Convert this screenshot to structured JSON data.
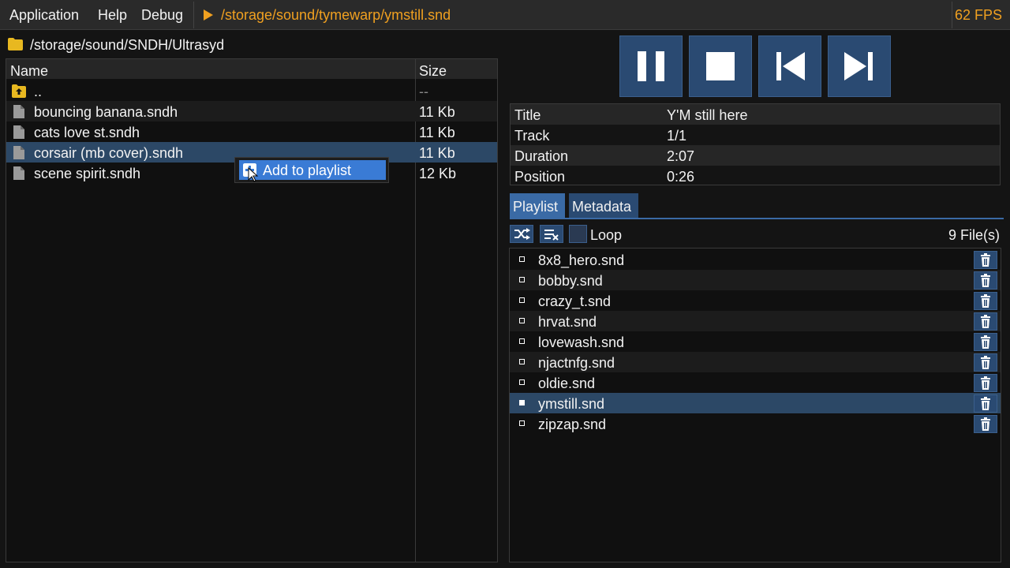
{
  "menubar": {
    "items": [
      "Application",
      "Help",
      "Debug"
    ],
    "now_playing": "/storage/sound/tymewarp/ymstill.snd",
    "fps": "62 FPS"
  },
  "browser": {
    "path": "/storage/sound/SNDH/Ultrasyd",
    "headers": {
      "name": "Name",
      "size": "Size"
    },
    "rows": [
      {
        "name": "..",
        "size": "--",
        "type": "parent-folder"
      },
      {
        "name": "bouncing banana.sndh",
        "size": "11 Kb",
        "type": "file"
      },
      {
        "name": "cats love st.sndh",
        "size": "11 Kb",
        "type": "file"
      },
      {
        "name": "corsair (mb cover).sndh",
        "size": "11 Kb",
        "type": "file",
        "selected": true
      },
      {
        "name": "scene spirit.sndh",
        "size": "12 Kb",
        "type": "file"
      }
    ]
  },
  "context_menu": {
    "item": "Add to playlist"
  },
  "transport": {
    "icons": [
      "pause-icon",
      "stop-icon",
      "previous-icon",
      "next-icon"
    ]
  },
  "info": [
    {
      "key": "Title",
      "value": "Y'M still here"
    },
    {
      "key": "Track",
      "value": "1/1"
    },
    {
      "key": "Duration",
      "value": "2:07"
    },
    {
      "key": "Position",
      "value": "0:26"
    }
  ],
  "tabs": [
    "Playlist",
    "Metadata"
  ],
  "playlist_controls": {
    "loop_label": "Loop",
    "file_count": "9 File(s)"
  },
  "playlist": [
    {
      "name": "8x8_hero.snd"
    },
    {
      "name": "bobby.snd"
    },
    {
      "name": "crazy_t.snd"
    },
    {
      "name": "hrvat.snd"
    },
    {
      "name": "lovewash.snd"
    },
    {
      "name": "njactnfg.snd"
    },
    {
      "name": "oldie.snd"
    },
    {
      "name": "ymstill.snd",
      "playing": true
    },
    {
      "name": "zipzap.snd"
    }
  ],
  "colors": {
    "accent": "#f0a020",
    "selection": "#2c4866",
    "button": "#2a4a72",
    "highlight": "#3a7bd5",
    "folder": "#e8b820"
  }
}
